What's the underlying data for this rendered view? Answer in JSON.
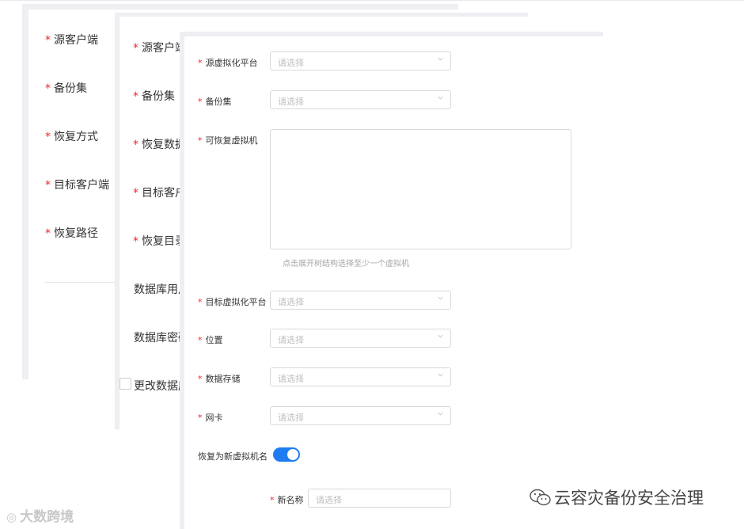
{
  "panel1": {
    "fields": [
      {
        "label": "源客户端",
        "required": true
      },
      {
        "label": "备份集",
        "required": true
      },
      {
        "label": "恢复方式",
        "required": true
      },
      {
        "label": "目标客户端",
        "required": true
      },
      {
        "label": "恢复路径",
        "required": true
      }
    ]
  },
  "panel2": {
    "fields": [
      {
        "label": "源客户端",
        "required": true
      },
      {
        "label": "备份集",
        "required": true
      },
      {
        "label": "恢复数据",
        "required": true
      },
      {
        "label": "目标客户",
        "required": true
      },
      {
        "label": "恢复目录",
        "required": true
      },
      {
        "label": "数据库用户",
        "required": false
      },
      {
        "label": "数据库密码",
        "required": false
      }
    ],
    "checkbox_label": "更改数据库"
  },
  "panel3": {
    "placeholder": "请选择",
    "fields": {
      "source_platform": "源虚拟化平台",
      "backup_set": "备份集",
      "recoverable_vm": "可恢复虚拟机",
      "target_platform": "目标虚拟化平台",
      "location": "位置",
      "datastore": "数据存储",
      "nic": "网卡",
      "restore_new_name": "恢复为新虚拟机名",
      "new_name": "新名称"
    },
    "tree_hint": "点击展开树结构选择至少一个虚拟机",
    "toggle_on": true
  },
  "required_mark": "*",
  "watermark_left": "大数跨境",
  "watermark_right": "云容灾备份安全治理",
  "colors": {
    "required": "#f5222d",
    "toggle": "#1f7cf0",
    "border": "#d9d9d9",
    "placeholder": "#bfbfbf"
  }
}
